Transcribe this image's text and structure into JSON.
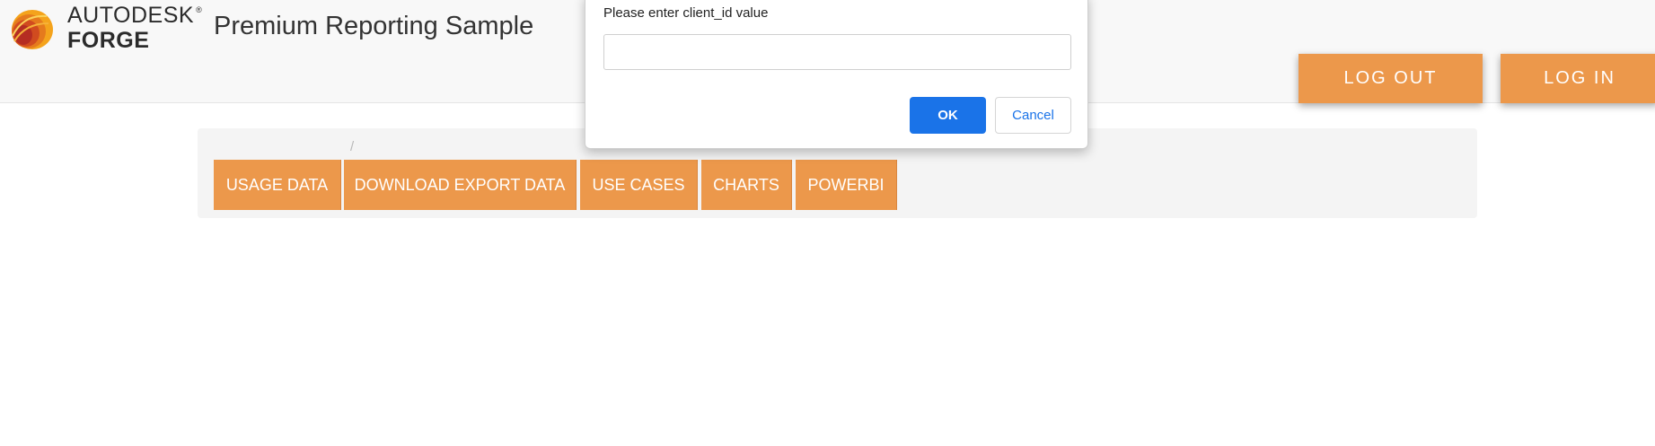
{
  "header": {
    "brand_top": "AUTODESK",
    "brand_reg": "®",
    "brand_bottom": "FORGE",
    "app_title": "Premium Reporting Sample",
    "logout_label": "LOG OUT",
    "login_label": "LOG IN",
    "accent_color": "#ec984b"
  },
  "nav": {
    "separator": "/",
    "items": [
      {
        "label": "USAGE DATA"
      },
      {
        "label": "DOWNLOAD EXPORT DATA"
      },
      {
        "label": "USE CASES"
      },
      {
        "label": "CHARTS"
      },
      {
        "label": "POWERBI"
      }
    ]
  },
  "dialog": {
    "message": "Please enter client_id value",
    "input_value": "",
    "ok_label": "OK",
    "cancel_label": "Cancel",
    "primary_color": "#1a73e8"
  }
}
